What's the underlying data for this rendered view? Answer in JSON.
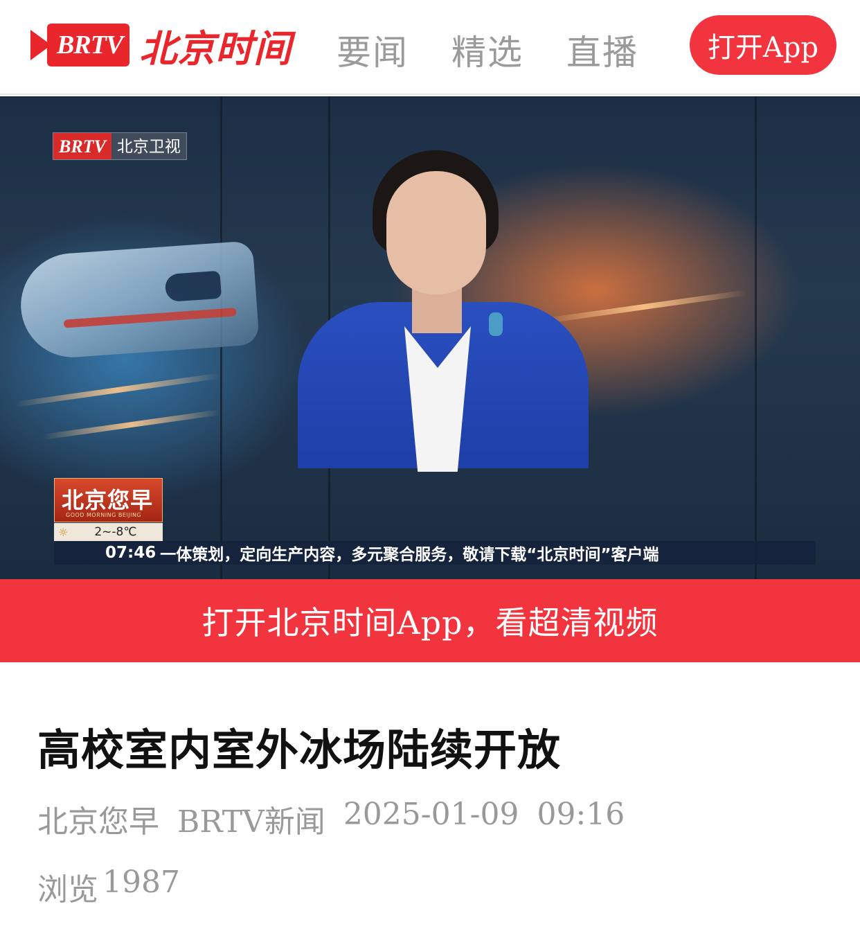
{
  "header": {
    "logo_brand": "BRTV",
    "logo_name": "北京时间",
    "nav": [
      "要闻",
      "精选",
      "直播"
    ],
    "open_app_button": "打开App"
  },
  "video": {
    "channel_badge_brand": "BRTV",
    "channel_badge_name": "北京卫视",
    "show_title": "北京您早",
    "show_subtitle": "GOOD MORNING BEIJING",
    "weather_temp": "2~-8℃",
    "ticker_time": "07:46",
    "ticker_text": "一体策划，定向生产内容，多元聚合服务，敬请下载“北京时间”客户端"
  },
  "app_banner": "打开北京时间App，看超清视频",
  "article": {
    "title": "高校室内室外冰场陆续开放",
    "program": "北京您早",
    "source": "BRTV新闻",
    "date": "2025-01-09",
    "time": "09:16",
    "views_label": "浏览",
    "views_count": "1987"
  },
  "colors": {
    "brand_red": "#f2343e",
    "meta_gray": "#999999",
    "nav_gray": "#9a9a9a"
  }
}
